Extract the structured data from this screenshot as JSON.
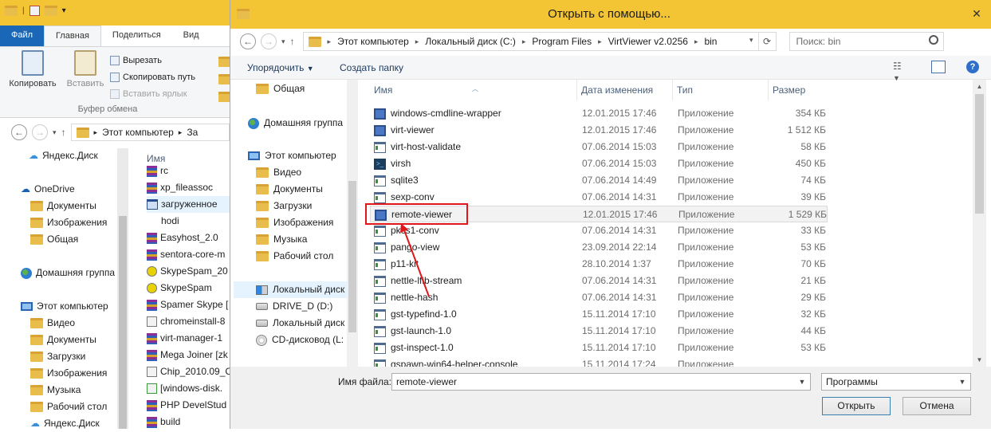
{
  "explorer": {
    "tabs": [
      "Файл",
      "Главная",
      "Поделиться",
      "Вид"
    ],
    "ribbon": {
      "copy": "Копировать",
      "paste": "Вставить",
      "cut": "Вырезать",
      "copy_path": "Скопировать путь",
      "paste_shortcut": "Вставить ярлык",
      "group_label": "Буфер обмена"
    },
    "address": [
      "Этот компьютер",
      "За"
    ],
    "nav": [
      "Яндекс.Диск",
      "OneDrive",
      "Документы",
      "Изображения",
      "Общая",
      "Домашняя группа",
      "Этот компьютер",
      "Видео",
      "Документы",
      "Загрузки",
      "Изображения",
      "Музыка",
      "Рабочий стол",
      "Яндекс.Диск"
    ],
    "list_header": "Имя",
    "files": [
      "rc",
      "xp_fileassoc",
      "загруженное",
      "hodi",
      "Easyhost_2.0",
      "sentora-core-m",
      "SkypeSpam_20",
      "SkypeSpam",
      "Spamer Skype [",
      "chromeinstall-8",
      "virt-manager-1",
      "Mega Joiner [zk",
      "Chip_2010.09_C",
      "[windows-disk.",
      "PHP DevelStud",
      "build"
    ]
  },
  "dialog": {
    "title": "Открыть с помощью...",
    "close": "✕",
    "address": [
      "Этот компьютер",
      "Локальный диск (C:)",
      "Program Files",
      "VirtViewer v2.0256",
      "bin"
    ],
    "search_placeholder": "Поиск: bin",
    "toolbar": {
      "organize": "Упорядочить",
      "new_folder": "Создать папку"
    },
    "nav": [
      {
        "label": "Общая",
        "icon": "folder-icon"
      },
      {
        "label": "Домашняя группа",
        "icon": "homegroup-icon"
      },
      {
        "label": "Этот компьютер",
        "icon": "computer-icon"
      },
      {
        "label": "Видео",
        "icon": "folder-icon"
      },
      {
        "label": "Документы",
        "icon": "folder-icon"
      },
      {
        "label": "Загрузки",
        "icon": "folder-icon"
      },
      {
        "label": "Изображения",
        "icon": "folder-icon"
      },
      {
        "label": "Музыка",
        "icon": "folder-icon"
      },
      {
        "label": "Рабочий стол",
        "icon": "folder-icon"
      },
      {
        "label": "Локальный диск",
        "icon": "windows-drive-icon"
      },
      {
        "label": "DRIVE_D (D:)",
        "icon": "drive-icon"
      },
      {
        "label": "Локальный диск",
        "icon": "drive-icon"
      },
      {
        "label": "CD-дисковод (L:",
        "icon": "cd-drive-icon"
      }
    ],
    "columns": {
      "name": "Имя",
      "date": "Дата изменения",
      "type": "Тип",
      "size": "Размер"
    },
    "files": [
      {
        "name": "windows-cmdline-wrapper",
        "date": "12.01.2015 17:46",
        "type": "Приложение",
        "size": "354 КБ",
        "icon": "monitor-icon"
      },
      {
        "name": "virt-viewer",
        "date": "12.01.2015 17:46",
        "type": "Приложение",
        "size": "1 512 КБ",
        "icon": "monitor-icon"
      },
      {
        "name": "virt-host-validate",
        "date": "07.06.2014 15:03",
        "type": "Приложение",
        "size": "58 КБ",
        "icon": "console-app-icon"
      },
      {
        "name": "virsh",
        "date": "07.06.2014 15:03",
        "type": "Приложение",
        "size": "450 КБ",
        "icon": "virsh-icon"
      },
      {
        "name": "sqlite3",
        "date": "07.06.2014 14:49",
        "type": "Приложение",
        "size": "74 КБ",
        "icon": "console-app-icon"
      },
      {
        "name": "sexp-conv",
        "date": "07.06.2014 14:31",
        "type": "Приложение",
        "size": "39 КБ",
        "icon": "console-app-icon"
      },
      {
        "name": "remote-viewer",
        "date": "12.01.2015 17:46",
        "type": "Приложение",
        "size": "1 529 КБ",
        "icon": "monitor-icon"
      },
      {
        "name": "pkcs1-conv",
        "date": "07.06.2014 14:31",
        "type": "Приложение",
        "size": "33 КБ",
        "icon": "console-app-icon"
      },
      {
        "name": "pango-view",
        "date": "23.09.2014 22:14",
        "type": "Приложение",
        "size": "53 КБ",
        "icon": "console-app-icon"
      },
      {
        "name": "p11-kit",
        "date": "28.10.2014 1:37",
        "type": "Приложение",
        "size": "70 КБ",
        "icon": "console-app-icon"
      },
      {
        "name": "nettle-lfib-stream",
        "date": "07.06.2014 14:31",
        "type": "Приложение",
        "size": "21 КБ",
        "icon": "console-app-icon"
      },
      {
        "name": "nettle-hash",
        "date": "07.06.2014 14:31",
        "type": "Приложение",
        "size": "29 КБ",
        "icon": "console-app-icon"
      },
      {
        "name": "gst-typefind-1.0",
        "date": "15.11.2014 17:10",
        "type": "Приложение",
        "size": "32 КБ",
        "icon": "console-app-icon"
      },
      {
        "name": "gst-launch-1.0",
        "date": "15.11.2014 17:10",
        "type": "Приложение",
        "size": "44 КБ",
        "icon": "console-app-icon"
      },
      {
        "name": "gst-inspect-1.0",
        "date": "15.11.2014 17:10",
        "type": "Приложение",
        "size": "53 КБ",
        "icon": "console-app-icon"
      },
      {
        "name": "gspawn-win64-helper-console",
        "date": "15.11.2014 17:24",
        "type": "Приложение",
        "size": "",
        "icon": "console-app-icon"
      }
    ],
    "selected_file": "remote-viewer",
    "filename_label": "Имя файла:",
    "filename_value": "remote-viewer",
    "filter_value": "Программы",
    "open_button": "Открыть",
    "cancel_button": "Отмена",
    "highlight_color": "#e0161b"
  }
}
